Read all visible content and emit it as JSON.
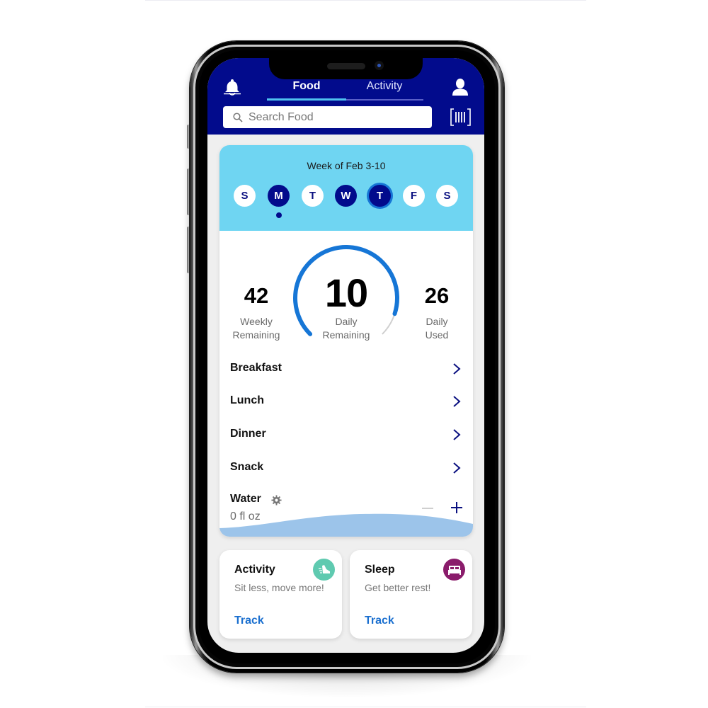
{
  "header": {
    "tabs": [
      {
        "label": "Food",
        "active": true
      },
      {
        "label": "Activity",
        "active": false
      }
    ],
    "search": {
      "placeholder": "Search Food",
      "value": ""
    },
    "icons": {
      "left": "bell-icon",
      "right": "profile-icon",
      "scan": "barcode-scan-icon"
    }
  },
  "week": {
    "label": "Week of Feb 3-10",
    "days": [
      {
        "letter": "S",
        "state": "empty"
      },
      {
        "letter": "M",
        "state": "filled",
        "marker": true
      },
      {
        "letter": "T",
        "state": "empty"
      },
      {
        "letter": "W",
        "state": "filled"
      },
      {
        "letter": "T",
        "state": "today"
      },
      {
        "letter": "F",
        "state": "empty"
      },
      {
        "letter": "S",
        "state": "empty"
      }
    ]
  },
  "summary": {
    "weekly_remaining": {
      "value": "42",
      "label_line1": "Weekly",
      "label_line2": "Remaining"
    },
    "daily_remaining": {
      "value": "10",
      "label_line1": "Daily",
      "label_line2": "Remaining"
    },
    "daily_used": {
      "value": "26",
      "label_line1": "Daily",
      "label_line2": "Used"
    },
    "gauge_fill_fraction": 0.9
  },
  "meals": [
    {
      "label": "Breakfast"
    },
    {
      "label": "Lunch"
    },
    {
      "label": "Dinner"
    },
    {
      "label": "Snack"
    }
  ],
  "water": {
    "label": "Water",
    "value": "0 fl oz"
  },
  "cards": [
    {
      "title": "Activity",
      "subtitle": "Sit less, move more!",
      "action": "Track",
      "icon": "sneaker-icon"
    },
    {
      "title": "Sleep",
      "subtitle": "Get better rest!",
      "action": "Track",
      "icon": "bed-icon"
    }
  ],
  "colors": {
    "header_navy": "#020b8c",
    "week_band": "#6fd5f2",
    "gauge_blue": "#1676d6",
    "track_link": "#1a6fcf",
    "activity_icon_bg": "#5fcab0",
    "sleep_icon_bg": "#8a1c6b"
  }
}
